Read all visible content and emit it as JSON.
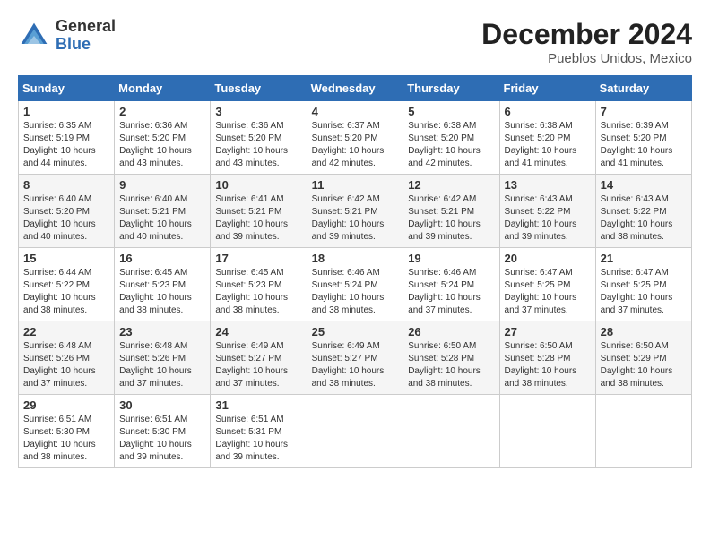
{
  "header": {
    "logo_general": "General",
    "logo_blue": "Blue",
    "month_title": "December 2024",
    "location": "Pueblos Unidos, Mexico"
  },
  "weekdays": [
    "Sunday",
    "Monday",
    "Tuesday",
    "Wednesday",
    "Thursday",
    "Friday",
    "Saturday"
  ],
  "weeks": [
    [
      {
        "day": "1",
        "sunrise": "6:35 AM",
        "sunset": "5:19 PM",
        "daylight": "10 hours and 44 minutes."
      },
      {
        "day": "2",
        "sunrise": "6:36 AM",
        "sunset": "5:20 PM",
        "daylight": "10 hours and 43 minutes."
      },
      {
        "day": "3",
        "sunrise": "6:36 AM",
        "sunset": "5:20 PM",
        "daylight": "10 hours and 43 minutes."
      },
      {
        "day": "4",
        "sunrise": "6:37 AM",
        "sunset": "5:20 PM",
        "daylight": "10 hours and 42 minutes."
      },
      {
        "day": "5",
        "sunrise": "6:38 AM",
        "sunset": "5:20 PM",
        "daylight": "10 hours and 42 minutes."
      },
      {
        "day": "6",
        "sunrise": "6:38 AM",
        "sunset": "5:20 PM",
        "daylight": "10 hours and 41 minutes."
      },
      {
        "day": "7",
        "sunrise": "6:39 AM",
        "sunset": "5:20 PM",
        "daylight": "10 hours and 41 minutes."
      }
    ],
    [
      {
        "day": "8",
        "sunrise": "6:40 AM",
        "sunset": "5:20 PM",
        "daylight": "10 hours and 40 minutes."
      },
      {
        "day": "9",
        "sunrise": "6:40 AM",
        "sunset": "5:21 PM",
        "daylight": "10 hours and 40 minutes."
      },
      {
        "day": "10",
        "sunrise": "6:41 AM",
        "sunset": "5:21 PM",
        "daylight": "10 hours and 39 minutes."
      },
      {
        "day": "11",
        "sunrise": "6:42 AM",
        "sunset": "5:21 PM",
        "daylight": "10 hours and 39 minutes."
      },
      {
        "day": "12",
        "sunrise": "6:42 AM",
        "sunset": "5:21 PM",
        "daylight": "10 hours and 39 minutes."
      },
      {
        "day": "13",
        "sunrise": "6:43 AM",
        "sunset": "5:22 PM",
        "daylight": "10 hours and 39 minutes."
      },
      {
        "day": "14",
        "sunrise": "6:43 AM",
        "sunset": "5:22 PM",
        "daylight": "10 hours and 38 minutes."
      }
    ],
    [
      {
        "day": "15",
        "sunrise": "6:44 AM",
        "sunset": "5:22 PM",
        "daylight": "10 hours and 38 minutes."
      },
      {
        "day": "16",
        "sunrise": "6:45 AM",
        "sunset": "5:23 PM",
        "daylight": "10 hours and 38 minutes."
      },
      {
        "day": "17",
        "sunrise": "6:45 AM",
        "sunset": "5:23 PM",
        "daylight": "10 hours and 38 minutes."
      },
      {
        "day": "18",
        "sunrise": "6:46 AM",
        "sunset": "5:24 PM",
        "daylight": "10 hours and 38 minutes."
      },
      {
        "day": "19",
        "sunrise": "6:46 AM",
        "sunset": "5:24 PM",
        "daylight": "10 hours and 37 minutes."
      },
      {
        "day": "20",
        "sunrise": "6:47 AM",
        "sunset": "5:25 PM",
        "daylight": "10 hours and 37 minutes."
      },
      {
        "day": "21",
        "sunrise": "6:47 AM",
        "sunset": "5:25 PM",
        "daylight": "10 hours and 37 minutes."
      }
    ],
    [
      {
        "day": "22",
        "sunrise": "6:48 AM",
        "sunset": "5:26 PM",
        "daylight": "10 hours and 37 minutes."
      },
      {
        "day": "23",
        "sunrise": "6:48 AM",
        "sunset": "5:26 PM",
        "daylight": "10 hours and 37 minutes."
      },
      {
        "day": "24",
        "sunrise": "6:49 AM",
        "sunset": "5:27 PM",
        "daylight": "10 hours and 37 minutes."
      },
      {
        "day": "25",
        "sunrise": "6:49 AM",
        "sunset": "5:27 PM",
        "daylight": "10 hours and 38 minutes."
      },
      {
        "day": "26",
        "sunrise": "6:50 AM",
        "sunset": "5:28 PM",
        "daylight": "10 hours and 38 minutes."
      },
      {
        "day": "27",
        "sunrise": "6:50 AM",
        "sunset": "5:28 PM",
        "daylight": "10 hours and 38 minutes."
      },
      {
        "day": "28",
        "sunrise": "6:50 AM",
        "sunset": "5:29 PM",
        "daylight": "10 hours and 38 minutes."
      }
    ],
    [
      {
        "day": "29",
        "sunrise": "6:51 AM",
        "sunset": "5:30 PM",
        "daylight": "10 hours and 38 minutes."
      },
      {
        "day": "30",
        "sunrise": "6:51 AM",
        "sunset": "5:30 PM",
        "daylight": "10 hours and 39 minutes."
      },
      {
        "day": "31",
        "sunrise": "6:51 AM",
        "sunset": "5:31 PM",
        "daylight": "10 hours and 39 minutes."
      },
      null,
      null,
      null,
      null
    ]
  ]
}
